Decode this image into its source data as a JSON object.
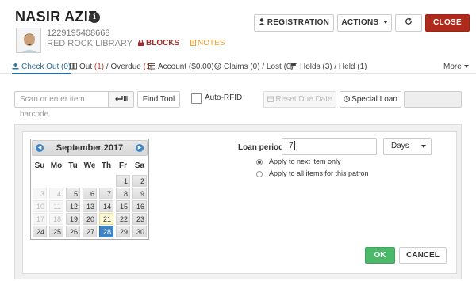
{
  "patron": {
    "name": "NASIR AZIZ",
    "barcode": "1229195408668",
    "library": "RED ROCK LIBRARY",
    "blocks_label": "BLOCKS",
    "notes_label": "NOTES"
  },
  "header_buttons": {
    "registration": "REGISTRATION",
    "actions": "ACTIONS",
    "close": "CLOSE"
  },
  "tabs": [
    {
      "label": "Check Out",
      "count": "(0)",
      "icon": "upload-icon"
    },
    {
      "label": "Out",
      "count": "(1)",
      "sep": " / Overdue ",
      "count2": "(1)",
      "icon": "book-icon"
    },
    {
      "label": "Account",
      "count": "($0.00)",
      "icon": "account-icon"
    },
    {
      "label": "Claims",
      "count": "(0) / Lost (0)",
      "icon": "smile-icon"
    },
    {
      "label": "Holds",
      "count": "(3) / Held (1)",
      "icon": "flag-icon"
    },
    {
      "label": "More",
      "icon": "caret-down-icon"
    }
  ],
  "toolbar": {
    "barcode_placeholder": "Scan or enter item barcode",
    "find_tool": "Find Tool",
    "auto_rfid": "Auto-RFID",
    "reset_due_date": "Reset Due Date",
    "special_loan": "Special Loan"
  },
  "calendar": {
    "title": "September 2017",
    "weekdays": [
      "Su",
      "Mo",
      "Tu",
      "We",
      "Th",
      "Fr",
      "Sa"
    ],
    "weeks": [
      [
        null,
        null,
        null,
        null,
        null,
        "1",
        "2"
      ],
      [
        "3",
        "4",
        "5",
        "6",
        "7",
        "8",
        "9"
      ],
      [
        "10",
        "11",
        "12",
        "13",
        "14",
        "15",
        "16"
      ],
      [
        "17",
        "18",
        "19",
        "20",
        "21",
        "22",
        "23"
      ],
      [
        "24",
        "25",
        "26",
        "27",
        "28",
        "29",
        "30"
      ]
    ],
    "today": "21",
    "selected": "28"
  },
  "loan": {
    "label": "Loan period:",
    "value": "7",
    "unit": "Days",
    "option_1": "Apply to next item only",
    "option_2": "Apply to all items for this patron",
    "selected_option": 1
  },
  "dialog_buttons": {
    "ok": "OK",
    "cancel": "CANCEL"
  }
}
